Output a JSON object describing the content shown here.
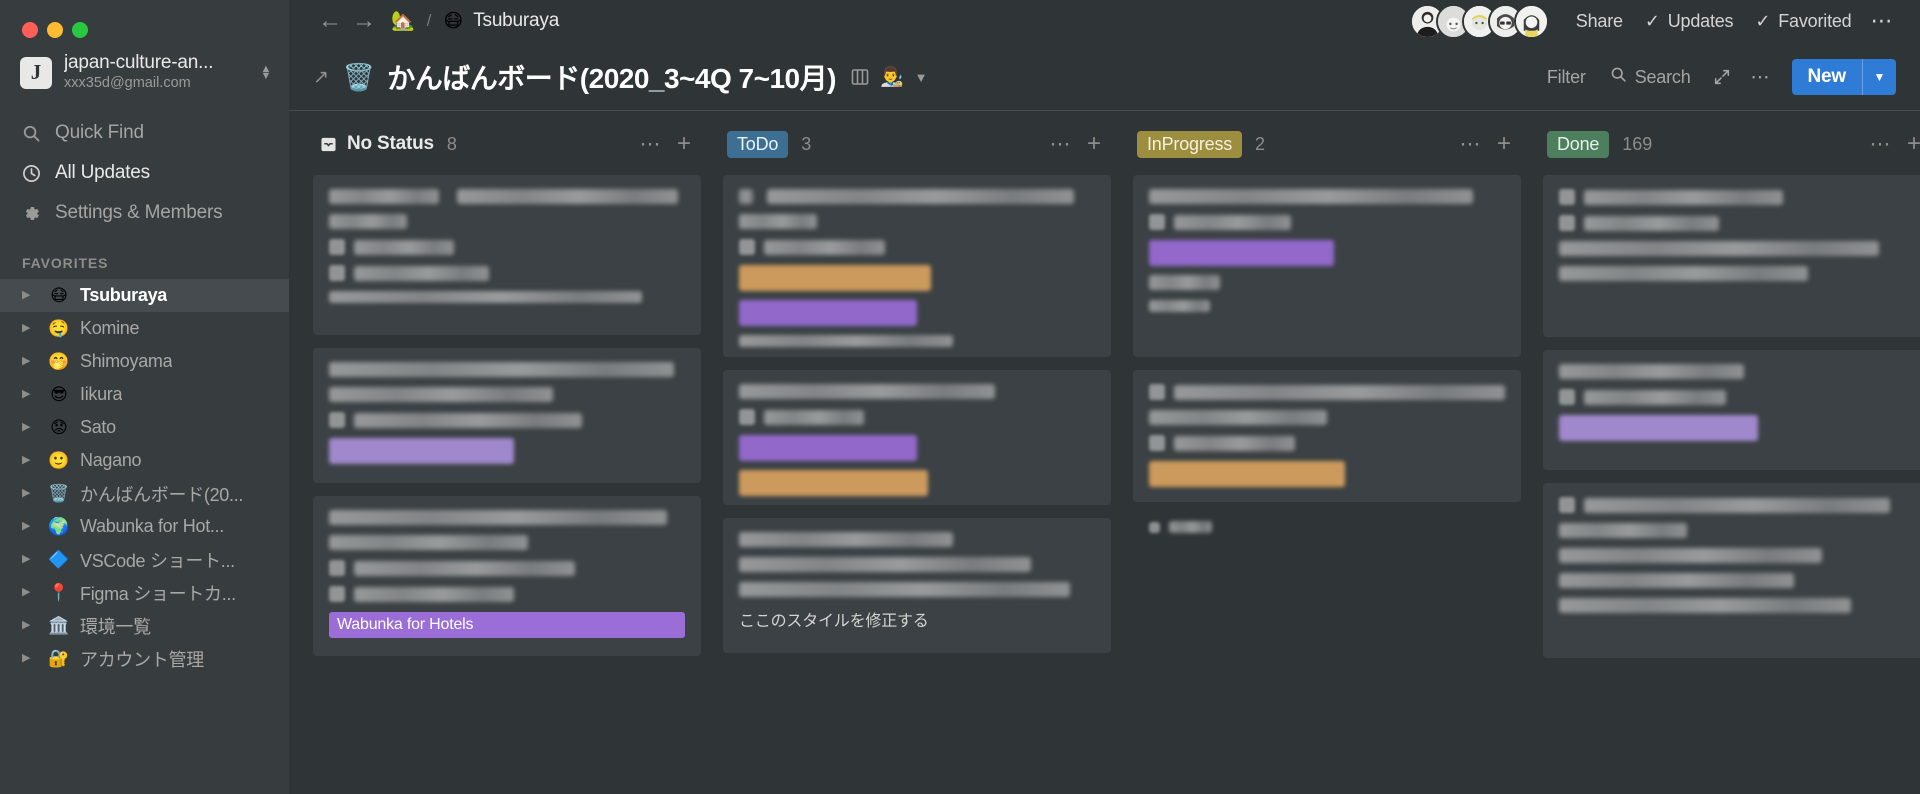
{
  "window": {
    "traffic_lights": [
      "close",
      "minimize",
      "maximize"
    ]
  },
  "sidebar": {
    "workspace": {
      "avatar_letter": "J",
      "name": "japan-culture-an...",
      "email": "xxx35d@gmail.com",
      "switcher_icon": "chevron-updown-icon"
    },
    "nav": [
      {
        "icon": "search-icon",
        "label": "Quick Find",
        "active": false
      },
      {
        "icon": "clock-icon",
        "label": "All Updates",
        "active": true
      },
      {
        "icon": "gear-icon",
        "label": "Settings & Members",
        "active": false
      }
    ],
    "favorites_header": "FAVORITES",
    "favorites": [
      {
        "emoji": "😷",
        "label": "Tsuburaya",
        "active": true
      },
      {
        "emoji": "🤤",
        "label": "Komine",
        "active": false
      },
      {
        "emoji": "🤭",
        "label": "Shimoyama",
        "active": false
      },
      {
        "emoji": "😎",
        "label": "Iikura",
        "active": false
      },
      {
        "emoji": "😟",
        "label": "Sato",
        "active": false
      },
      {
        "emoji": "🙂",
        "label": "Nagano",
        "active": false
      },
      {
        "emoji": "🗑️",
        "label": "かんばんボード(20...",
        "active": false
      },
      {
        "emoji": "🌍",
        "label": "Wabunka for Hot...",
        "active": false
      },
      {
        "emoji": "🔷",
        "label": "VSCode ショート...",
        "active": false
      },
      {
        "emoji": "📍",
        "label": "Figma ショートカ...",
        "active": false
      },
      {
        "emoji": "🏛️",
        "label": "環境一覧",
        "active": false
      },
      {
        "emoji": "🔐",
        "label": "アカウント管理",
        "active": false
      }
    ]
  },
  "topbar": {
    "back_icon": "arrow-left-icon",
    "forward_icon": "arrow-right-icon",
    "breadcrumb": {
      "home_emoji": "🏡",
      "separator": "/",
      "page_emoji": "😷",
      "page_name": "Tsuburaya"
    },
    "avatars_count": 5,
    "share_label": "Share",
    "updates_label": "Updates",
    "updates_icon": "check-icon",
    "favorited_label": "Favorited",
    "favorited_icon": "check-icon",
    "more_icon": "ellipsis-icon"
  },
  "board_header": {
    "expand_icon": "arrow-up-right-icon",
    "emoji": "🗑️",
    "title": "かんばんボード(2020_3~4Q 7~10月)",
    "board_icon": "board-icon",
    "avatar_emoji": "👨‍🎨",
    "caret_icon": "chevron-down-icon",
    "filter_label": "Filter",
    "search_label": "Search",
    "search_icon": "search-icon",
    "expand_view_icon": "expand-icon",
    "more_icon": "ellipsis-icon",
    "new_label": "New",
    "new_caret_icon": "chevron-down-icon"
  },
  "columns": [
    {
      "id": "no-status",
      "title": "No Status",
      "count": "8",
      "icon": "inbox-icon",
      "pill": false,
      "pill_bg": "",
      "pill_fg": "",
      "cards": [
        {
          "lines": [
            100,
            46
          ],
          "rows": [
            1,
            1
          ],
          "tags": [],
          "texts": []
        },
        {
          "lines": [
            100,
            62
          ],
          "rows": [
            1
          ],
          "tags": [
            "lav"
          ],
          "texts": []
        },
        {
          "lines": [
            96,
            58
          ],
          "rows": [
            1,
            1
          ],
          "tags": [],
          "texts": [],
          "real_tag": "Wabunka for Hotels"
        }
      ]
    },
    {
      "id": "todo",
      "title": "ToDo",
      "count": "3",
      "icon": "",
      "pill": true,
      "pill_bg": "#3d6f93",
      "pill_fg": "#e9f2f8",
      "cards": [
        {
          "lines": [
            100,
            26
          ],
          "rows": [
            1
          ],
          "tags": [
            "orange",
            "purple"
          ],
          "texts": [
            "blurred"
          ]
        },
        {
          "lines": [
            75
          ],
          "rows": [
            1
          ],
          "tags": [
            "purple",
            "orange"
          ],
          "texts": []
        },
        {
          "lines": [
            62,
            84,
            94
          ],
          "rows": [],
          "tags": [],
          "texts": [
            "ここのスタイルを修正する"
          ]
        }
      ]
    },
    {
      "id": "inprogress",
      "title": "InProgress",
      "count": "2",
      "icon": "",
      "pill": true,
      "pill_bg": "#9c8d3f",
      "pill_fg": "#f5f1df",
      "cards": [
        {
          "lines": [
            92
          ],
          "rows": [
            1
          ],
          "tags": [
            "purple"
          ],
          "texts": []
        },
        {
          "lines": [
            97,
            52
          ],
          "rows": [
            1
          ],
          "tags": [
            "orange"
          ],
          "texts": []
        }
      ],
      "footer_row": true
    },
    {
      "id": "done",
      "title": "Done",
      "count": "169",
      "icon": "",
      "pill": true,
      "pill_bg": "#4d7f5e",
      "pill_fg": "#e3f1e8",
      "cards": [
        {
          "lines": [
            70,
            88,
            80
          ],
          "rows": [
            1
          ],
          "tags": [],
          "texts": []
        },
        {
          "lines": [
            62
          ],
          "rows": [
            1
          ],
          "tags": [
            "lav"
          ],
          "texts": []
        },
        {
          "lines": [
            86,
            44,
            72,
            66,
            78
          ],
          "rows": [],
          "tags": [],
          "texts": []
        }
      ]
    }
  ]
}
